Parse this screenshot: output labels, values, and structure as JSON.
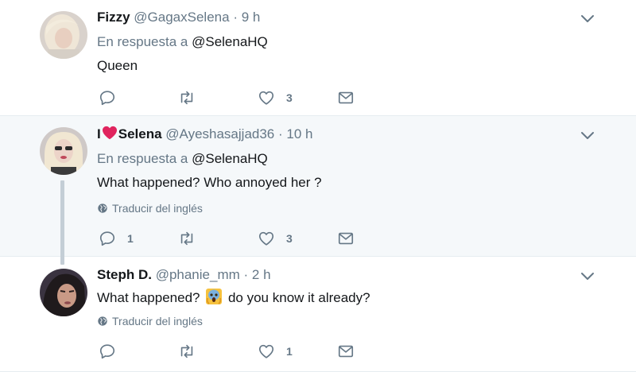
{
  "tweets": [
    {
      "name_text": "Fizzy",
      "handle": "@GagaxSelena",
      "dot": "·",
      "time": "9 h",
      "reply_prefix": "En respuesta a",
      "reply_mention": "@SelenaHQ",
      "text": "Queen",
      "actions": {
        "reply_count": "",
        "retweet_count": "",
        "like_count": "3"
      }
    },
    {
      "name_prefix": "I",
      "name_text": "Selena",
      "handle": "@Ayeshasajjad36",
      "dot": "·",
      "time": "10 h",
      "reply_prefix": "En respuesta a",
      "reply_mention": "@SelenaHQ",
      "text": "What happened? Who annoyed her ?",
      "translate": "Traducir del inglés",
      "actions": {
        "reply_count": "1",
        "retweet_count": "",
        "like_count": "3"
      }
    },
    {
      "name_text": "Steph D.",
      "handle": "@phanie_mm",
      "dot": "·",
      "time": "2 h",
      "text_before": "What happened?",
      "text_after": "do you know it already?",
      "translate": "Traducir del inglés",
      "actions": {
        "reply_count": "",
        "retweet_count": "",
        "like_count": "1"
      }
    }
  ],
  "icons": {
    "reply": "reply-icon",
    "retweet": "retweet-icon",
    "like": "heart-icon",
    "dm": "envelope-icon",
    "menu": "chevron-down-icon",
    "globe": "globe-icon",
    "emoji": "screaming-face-emoji"
  },
  "colors": {
    "icon_gray": "#657786",
    "text_dark": "#14171a",
    "highlight_bg": "#f5f8fa",
    "heart_red": "#e0245e"
  }
}
